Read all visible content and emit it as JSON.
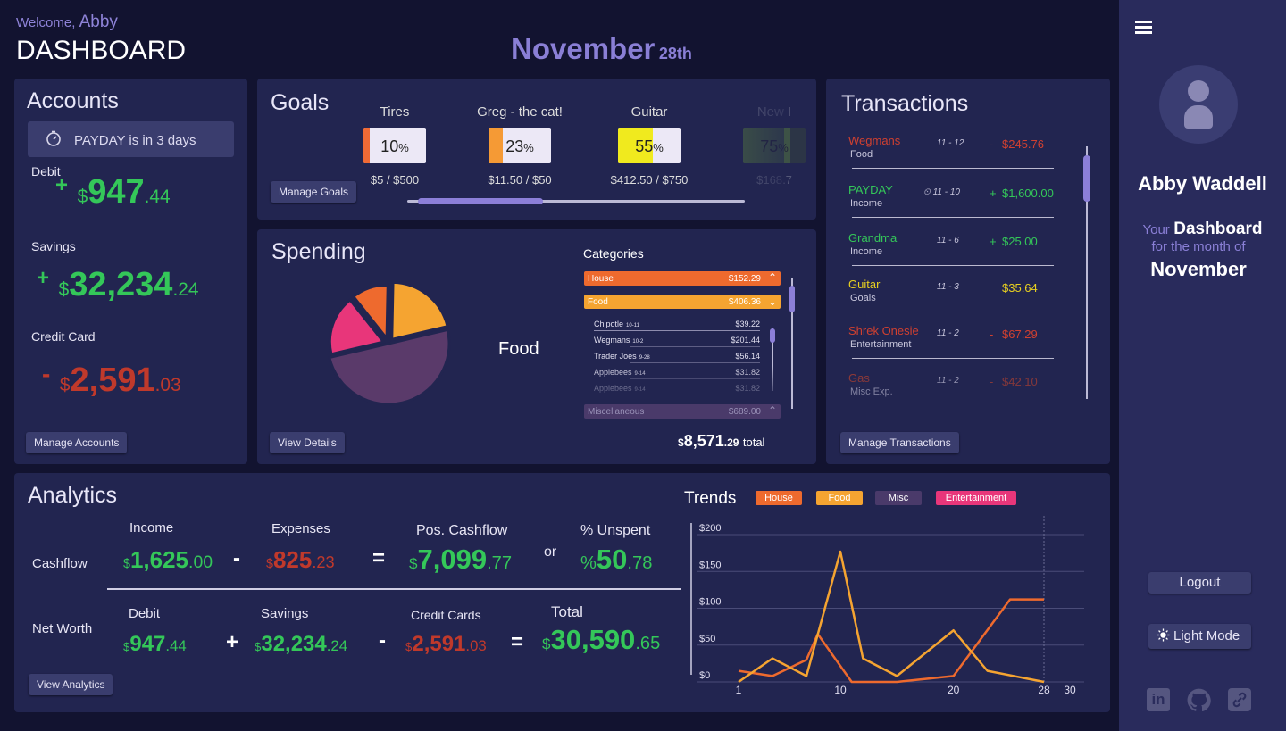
{
  "header": {
    "welcome_prefix": "Welcome,",
    "user_first": "Abby",
    "title": "DASHBOARD",
    "month": "November",
    "day": "28th"
  },
  "accounts": {
    "title": "Accounts",
    "payday_bold": "PAYDAY",
    "payday_text": "is in 3 days",
    "debit": {
      "label": "Debit",
      "sign": "+",
      "currency": "$",
      "whole": "947",
      "cents": ".44"
    },
    "savings": {
      "label": "Savings",
      "sign": "+",
      "currency": "$",
      "whole": "32,234",
      "cents": ".24"
    },
    "credit": {
      "label": "Credit Card",
      "sign": "-",
      "currency": "$",
      "whole": "2,591",
      "cents": ".03"
    },
    "manage_label": "Manage Accounts"
  },
  "goals": {
    "title": "Goals",
    "manage_label": "Manage Goals",
    "items": [
      {
        "name": "Tires",
        "pct": "10",
        "amount": "$5 / $500",
        "fill": 0.1,
        "color": "#f06a35"
      },
      {
        "name": "Greg - the cat!",
        "pct": "23",
        "amount": "$11.50 / $50",
        "fill": 0.23,
        "color": "#f59a35"
      },
      {
        "name": "Guitar",
        "pct": "55",
        "amount": "$412.50 / $750",
        "fill": 0.55,
        "color": "#f0ea1e"
      },
      {
        "name": "New I",
        "pct": "75",
        "amount": "$168.7",
        "fill": 0.75,
        "color": "#5f8a3a"
      }
    ],
    "scroll_fraction": 0.37
  },
  "spending": {
    "title": "Spending",
    "center_label": "Food",
    "view_label": "View Details",
    "total_currency": "$",
    "total_whole": "8,571",
    "total_cents": ".29",
    "total_word": "total",
    "categories_title": "Categories",
    "categories": [
      {
        "name": "House",
        "amount": "$152.29",
        "color": "#ee6a2e"
      },
      {
        "name": "Food",
        "amount": "$406.36",
        "color": "#f5a431"
      },
      {
        "name": "Miscellaneous",
        "amount": "$689.00",
        "color": "#4a3a6a"
      }
    ],
    "food_items": [
      {
        "name": "Chipotle",
        "date": "10-11",
        "amount": "$39.22"
      },
      {
        "name": "Wegmans",
        "date": "10-2",
        "amount": "$201.44"
      },
      {
        "name": "Trader Joes",
        "date": "9-28",
        "amount": "$56.14"
      },
      {
        "name": "Applebees",
        "date": "9-14",
        "amount": "$31.82"
      },
      {
        "name": "Applebees",
        "date": "9-14",
        "amount": "$31.82"
      }
    ],
    "pie": [
      {
        "label": "Food",
        "fraction": 0.5,
        "color": "#5a3a6a"
      },
      {
        "label": "Entertainment",
        "fraction": 0.18,
        "color": "#e8367a"
      },
      {
        "label": "House",
        "fraction": 0.11,
        "color": "#ee6a2e"
      },
      {
        "label": "Misc",
        "fraction": 0.21,
        "color": "#f5a431"
      }
    ]
  },
  "transactions": {
    "title": "Transactions",
    "manage_label": "Manage Transactions",
    "items": [
      {
        "name": "Wegmans",
        "type": "Food",
        "date": "11 - 12",
        "sign": "-",
        "amount": "$245.76",
        "color": "#d04030",
        "recurring": false
      },
      {
        "name": "PAYDAY",
        "type": "Income",
        "date": "11 - 10",
        "sign": "+",
        "amount": "$1,600.00",
        "color": "#34c759",
        "recurring": true
      },
      {
        "name": "Grandma",
        "type": "Income",
        "date": "11 - 6",
        "sign": "+",
        "amount": "$25.00",
        "color": "#34c759",
        "recurring": false
      },
      {
        "name": "Guitar",
        "type": "Goals",
        "date": "11 - 3",
        "sign": "",
        "amount": "$35.64",
        "color": "#e8d020",
        "recurring": false
      },
      {
        "name": "Shrek Onesie",
        "type": "Entertainment",
        "date": "11 - 2",
        "sign": "-",
        "amount": "$67.29",
        "color": "#d04030",
        "recurring": false
      },
      {
        "name": "Gas",
        "type": "Misc Exp.",
        "date": "11 - 2",
        "sign": "-",
        "amount": "$42.10",
        "color": "#b04030",
        "recurring": false
      }
    ]
  },
  "analytics": {
    "title": "Analytics",
    "view_label": "View Analytics",
    "cashflow_label": "Cashflow",
    "networth_label": "Net Worth",
    "income": {
      "label": "Income",
      "whole": "1,625",
      "cents": ".00"
    },
    "expenses": {
      "label": "Expenses",
      "whole": "825",
      "cents": ".23"
    },
    "pos_cashflow": {
      "label": "Pos. Cashflow",
      "whole": "7,099",
      "cents": ".77"
    },
    "or": "or",
    "unspent": {
      "label": "% Unspent",
      "prefix": "%",
      "whole": "50",
      "cents": ".78"
    },
    "debit": {
      "label": "Debit",
      "whole": "947",
      "cents": ".44"
    },
    "savings": {
      "label": "Savings",
      "whole": "32,234",
      "cents": ".24"
    },
    "credit": {
      "label": "Credit Cards",
      "whole": "2,591",
      "cents": ".03"
    },
    "total": {
      "label": "Total",
      "whole": "30,590",
      "cents": ".65"
    },
    "ops": {
      "minus": "-",
      "plus": "+",
      "eq": "="
    },
    "currency": "$"
  },
  "chart_data": {
    "type": "line",
    "title": "Trends",
    "legend": [
      "House",
      "Food",
      "Misc",
      "Entertainment"
    ],
    "legend_colors": [
      "#ee6a2e",
      "#f5a431",
      "#4a3a6a",
      "#e8367a"
    ],
    "xlim": [
      0,
      30
    ],
    "ylim": [
      0,
      200
    ],
    "xticks": [
      1,
      10,
      20,
      28,
      30
    ],
    "yticks": [
      0,
      50,
      100,
      150,
      200
    ],
    "ytick_labels": [
      "$0",
      "$50",
      "$100",
      "$150",
      "$200"
    ],
    "series": [
      {
        "name": "House",
        "color": "#ee6a2e",
        "x": [
          1,
          4,
          7,
          8,
          11,
          15,
          20,
          25,
          28
        ],
        "y": [
          15,
          8,
          30,
          65,
          0,
          0,
          8,
          112,
          112
        ]
      },
      {
        "name": "Food",
        "color": "#f5a431",
        "x": [
          1,
          4,
          7,
          10,
          12,
          15,
          20,
          23,
          28
        ],
        "y": [
          0,
          32,
          8,
          177,
          32,
          8,
          70,
          15,
          0
        ]
      }
    ]
  },
  "sidebar": {
    "name": "Abby Waddell",
    "your": "Your",
    "dashboard": "Dashboard",
    "for_month": "for the month of",
    "month": "November",
    "logout": "Logout",
    "light_mode": "Light Mode"
  }
}
